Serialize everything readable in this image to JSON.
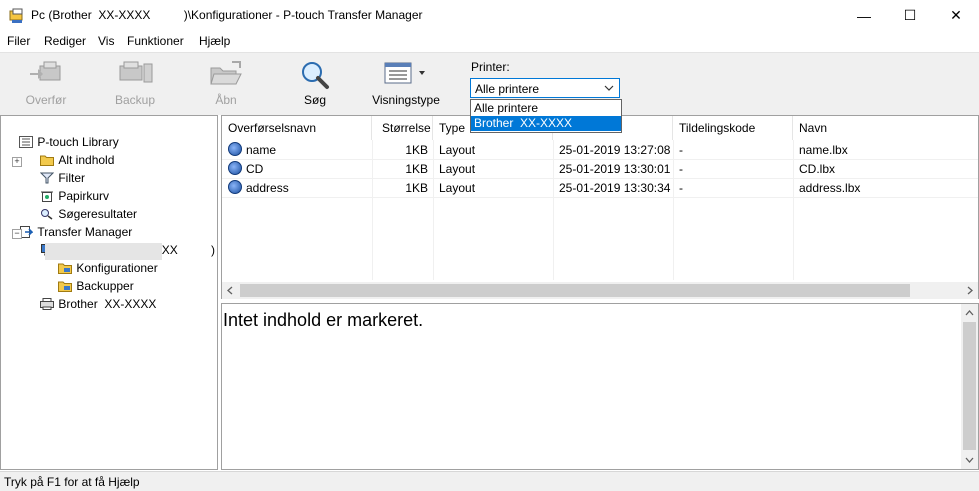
{
  "window": {
    "title": "Pc (Brother  XX-XXXX          )\\Konfigurationer - P-touch Transfer Manager",
    "minimize": "—",
    "maximize": "☐",
    "close": "✕"
  },
  "menu": {
    "items": [
      {
        "label": "Filer"
      },
      {
        "label": "Rediger"
      },
      {
        "label": "Vis"
      },
      {
        "label": "Funktioner"
      },
      {
        "label": "Hjælp"
      }
    ]
  },
  "toolbar": {
    "transfer": "Overfør",
    "backup": "Backup",
    "open": "Åbn",
    "search": "Søg",
    "view_type": "Visningstype",
    "printer_label": "Printer:",
    "printer_selected": "Alle printere",
    "printer_options": [
      "Alle printere",
      "Brother  XX-XXXX"
    ]
  },
  "tree": {
    "library": "P-touch Library",
    "all_content": "Alt indhold",
    "filter": "Filter",
    "trash": "Papirkurv",
    "search_results": "Søgeresultater",
    "transfer_manager": "Transfer Manager",
    "pc": "Pc (Brother  XX-XXXX          )",
    "configurations": "Konfigurationer",
    "backups": "Backupper",
    "printer": "Brother  XX-XXXX"
  },
  "list": {
    "columns": [
      "Overførselsnavn",
      "Størrelse",
      "Type",
      "",
      "Tildelingskode",
      "Navn"
    ],
    "rows": [
      {
        "name": "name",
        "size": "1KB",
        "type": "Layout",
        "date": "25-01-2019 13:27:08",
        "code": "-",
        "file": "name.lbx"
      },
      {
        "name": "CD",
        "size": "1KB",
        "type": "Layout",
        "date": "25-01-2019 13:30:01",
        "code": "-",
        "file": "CD.lbx"
      },
      {
        "name": "address",
        "size": "1KB",
        "type": "Layout",
        "date": "25-01-2019 13:30:34",
        "code": "-",
        "file": "address.lbx"
      }
    ]
  },
  "preview": {
    "message": "Intet indhold er markeret."
  },
  "status": {
    "text": "Tryk på F1 for at få Hjælp"
  },
  "colors": {
    "accent": "#0078d7",
    "toolbar_bg": "#f0f0f0"
  }
}
